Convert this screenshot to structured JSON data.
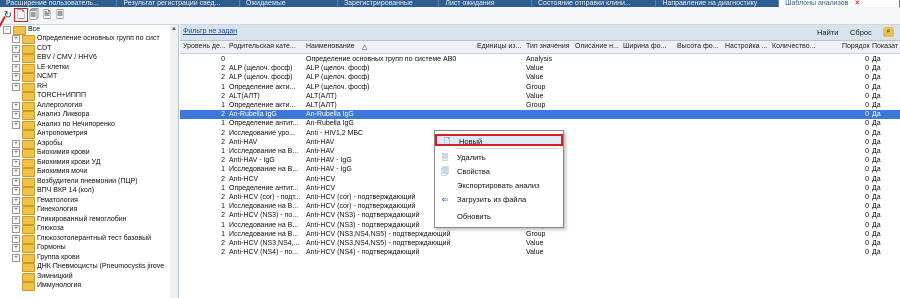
{
  "tabs": [
    {
      "label": "Расширение пользователь..."
    },
    {
      "label": "Результат регистрации свед..."
    },
    {
      "label": "Ожидаемые"
    },
    {
      "label": "Зарегистрированные"
    },
    {
      "label": "Лист ожидания"
    },
    {
      "label": "Состояние отправки клини..."
    },
    {
      "label": "Направление на диагностику"
    },
    {
      "label": "Шаблоны анализов",
      "close": "✕"
    }
  ],
  "toolbar": {
    "icons": [
      "refresh-icon",
      "new-doc-icon",
      "copy-doc-icon",
      "edit-doc-icon",
      "delete-doc-icon"
    ]
  },
  "tree": {
    "root": "Все",
    "items": [
      "Определение основных групп по сист",
      "CDT",
      "EBV / CMV / HHV6",
      "LE-клетки",
      "NCMT",
      "RH",
      "TORCH+ИППП",
      "Аллергология",
      "Анализ Ликвора",
      "Анализ по Нечипоренко",
      "Антропометрия",
      "Аэробы",
      "Биохимия крови",
      "Биохимия крови УД",
      "Биохимия мочи",
      "Возбудители пневмонии (ПЦР)",
      "ВПЧ ВКР 14 (кол)",
      "Гематология",
      "Гинекология",
      "Гликированный гемоглобин",
      "Глюкоза",
      "Глюкозотолерантный тест базовый",
      "Гормоны",
      "Группа крови",
      "ДНК Пневмоцисты (Pneumocystis jirove",
      "Зимницкий",
      "Иммунология"
    ]
  },
  "filter": {
    "link": "Фильтр не задан",
    "find": "Найти",
    "reset": "Сброс"
  },
  "grid": {
    "columns": [
      "Уровень де...",
      "Родительская кате...",
      "Наименование",
      "Единицы из...",
      "Тип значения",
      "Описание н...",
      "Ширина фо...",
      "Высота фо...",
      "Настройка ...",
      "Количество...",
      "Порядок",
      "Показат"
    ],
    "sort_mark": "△",
    "rows": [
      [
        "0",
        "",
        "Определение основных групп по системе АВ0",
        "",
        "Analysis",
        "0",
        "Да"
      ],
      [
        "2",
        "ALP (щелоч. фосф)",
        "ALP (щелоч. фосф)",
        "",
        "Value",
        "0",
        "Да"
      ],
      [
        "2",
        "ALP (щелоч. фосф)",
        "ALP (щелоч. фосф)",
        "",
        "Value",
        "0",
        "Да"
      ],
      [
        "1",
        "Определение акти...",
        "ALP (щелоч. фосф)",
        "",
        "Group",
        "0",
        "Да"
      ],
      [
        "2",
        "ALT(АЛТ)",
        "ALT(АЛТ)",
        "",
        "Value",
        "0",
        "Да"
      ],
      [
        "1",
        "Определение акти...",
        "ALT(АЛТ)",
        "",
        "Group",
        "0",
        "Да"
      ],
      [
        "2",
        "An-Rubella IgG",
        "An-Rubella IgG",
        "",
        "",
        "0",
        "Да"
      ],
      [
        "1",
        "Определение антит...",
        "An-Rubella IgG",
        "",
        "",
        "0",
        "Да"
      ],
      [
        "2",
        "Исследование уро...",
        "Anti - HIV1,2 МБС",
        "",
        "",
        "0",
        "Да"
      ],
      [
        "2",
        "Anti-HAV",
        "Anti-HAV",
        "",
        "",
        "0",
        "Да"
      ],
      [
        "1",
        "Исследование на В...",
        "Anti-HAV",
        "",
        "",
        "0",
        "Да"
      ],
      [
        "2",
        "Anti-HAV - IgG",
        "Anti-HAV - IgG",
        "",
        "",
        "0",
        "Да"
      ],
      [
        "1",
        "Исследование на В...",
        "Anti-HAV - IgG",
        "",
        "",
        "0",
        "Да"
      ],
      [
        "2",
        "Anti-HCV",
        "Anti-HCV",
        "",
        "",
        "0",
        "Да"
      ],
      [
        "1",
        "Определение антит...",
        "Anti-HCV",
        "",
        "",
        "0",
        "Да"
      ],
      [
        "2",
        "Anti-HCV (cor) - подт...",
        "Anti-HCV (cor) - подтверждающий",
        "",
        "Value",
        "0",
        "Да"
      ],
      [
        "1",
        "Исследование на В...",
        "Anti-HCV (cor) - подтверждающий",
        "",
        "Group",
        "0",
        "Да"
      ],
      [
        "2",
        "Anti-HCV (NS3) - по...",
        "Anti-HCV (NS3) - подтверждающий",
        "",
        "Value",
        "0",
        "Да"
      ],
      [
        "1",
        "Исследование на В...",
        "Anti-HCV (NS3) - подтверждающий",
        "",
        "Group",
        "0",
        "Да"
      ],
      [
        "1",
        "Исследование на В...",
        "Anti-HCV (NS3,NS4,NS5) - подтверждающий",
        "",
        "Group",
        "0",
        "Да"
      ],
      [
        "2",
        "Anti-HCV (NS3,NS4,...",
        "Anti-HCV (NS3,NS4,NS5) - подтверждающий",
        "",
        "Value",
        "0",
        "Да"
      ],
      [
        "2",
        "Anti-HCV (NS4) - по...",
        "Anti-HCV (NS4) - подтверждающий",
        "",
        "Value",
        "0",
        "Да"
      ]
    ]
  },
  "context_menu": {
    "items": [
      {
        "label": "Новый",
        "icon": "new-doc-icon"
      },
      {
        "label": "Удалить",
        "icon": "delete-doc-icon"
      },
      {
        "label": "Свойства",
        "icon": "properties-icon"
      },
      {
        "label": "Экспортировать анализ",
        "icon": ""
      },
      {
        "label": "Загрузить из файла",
        "icon": "import-icon"
      },
      {
        "label": "Обновить",
        "icon": ""
      }
    ]
  },
  "colors": {
    "selection": "#3b78d8",
    "highlight_border": "#d42020",
    "tab_bar": "#2e5d8f"
  }
}
